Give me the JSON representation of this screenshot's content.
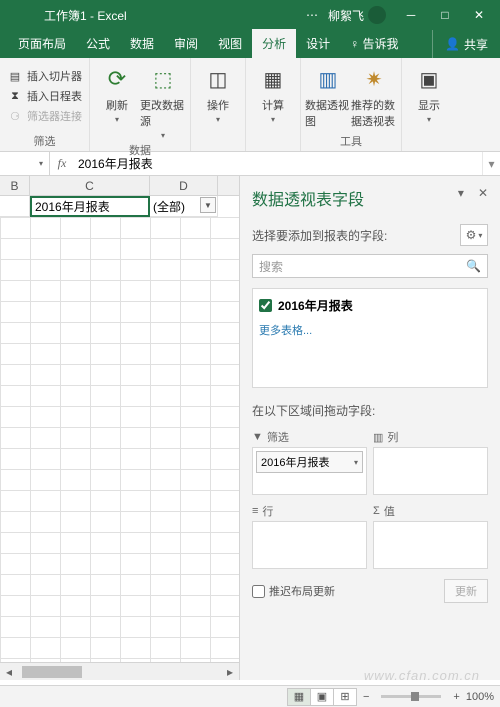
{
  "titlebar": {
    "doc": "工作簿1 - Excel",
    "user": "柳絮飞"
  },
  "tabs": {
    "t0": "页面布局",
    "t1": "公式",
    "t2": "数据",
    "t3": "审阅",
    "t4": "视图",
    "t5": "分析",
    "t6": "设计",
    "t7": "告诉我",
    "share": "共享"
  },
  "ribbon": {
    "filter_group": "筛选",
    "slicer": "插入切片器",
    "timeline": "插入日程表",
    "filtconn": "筛选器连接",
    "data_group": "数据",
    "refresh": "刷新",
    "changesrc": "更改数据源",
    "actions": "操作",
    "calc": "计算",
    "tools_group": "工具",
    "pivchart": "数据透视图",
    "recommend": "推荐的数据透视表",
    "display": "显示"
  },
  "formula": {
    "fx": "fx",
    "value": "2016年月报表"
  },
  "cols": {
    "B": "B",
    "C": "C",
    "D": "D"
  },
  "cells": {
    "C1": "2016年月报表",
    "D1": "(全部)"
  },
  "panel": {
    "title": "数据透视表字段",
    "choose": "选择要添加到报表的字段:",
    "search": "搜索",
    "field1": "2016年月报表",
    "more": "更多表格...",
    "dragtitle": "在以下区域间拖动字段:",
    "z_filter": "筛选",
    "z_cols": "列",
    "z_rows": "行",
    "z_vals": "值",
    "chip": "2016年月报表",
    "defer": "推迟布局更新",
    "update": "更新"
  },
  "status": {
    "zoom": "100%",
    "minus": "−",
    "plus": "+"
  },
  "watermark": "www.cfan.com.cn"
}
